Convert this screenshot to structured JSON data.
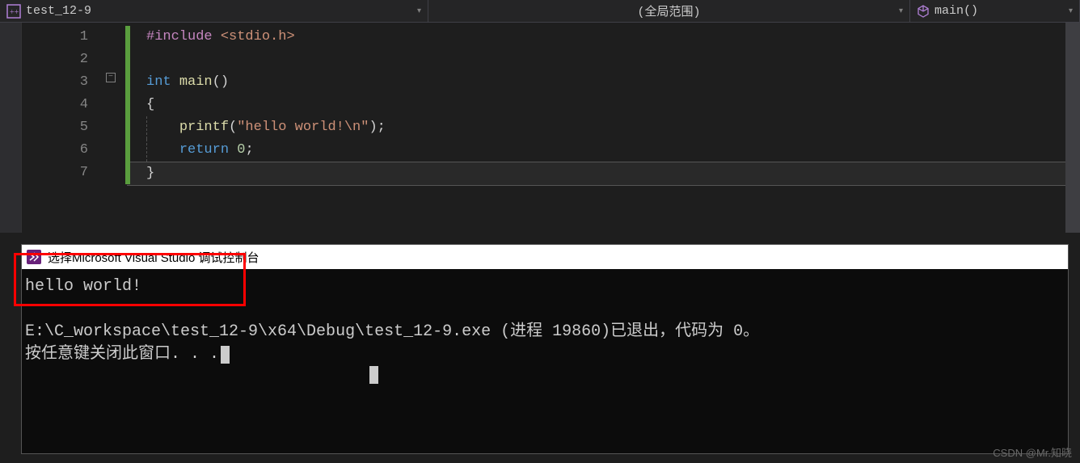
{
  "topbar": {
    "file_label": "test_12-9",
    "scope_label": "(全局范围)",
    "function_label": "main()"
  },
  "editor": {
    "line_numbers": [
      "1",
      "2",
      "3",
      "4",
      "5",
      "6",
      "7"
    ],
    "code": {
      "l1_include": "#include",
      "l1_header": "<stdio.h>",
      "l3_int": "int",
      "l3_main": "main",
      "l3_parens": "()",
      "l4_brace": "{",
      "l5_printf": "printf",
      "l5_open": "(",
      "l5_str": "\"hello world!\\n\"",
      "l5_close": ");",
      "l6_return": "return",
      "l6_zero": "0",
      "l6_semi": ";",
      "l7_brace": "}"
    }
  },
  "console": {
    "title": "选择Microsoft Visual Studio 调试控制台",
    "output_line1": "hello world!",
    "output_line2": "E:\\C_workspace\\test_12-9\\x64\\Debug\\test_12-9.exe (进程 19860)已退出，代码为 0。",
    "output_line3": "按任意键关闭此窗口. . ."
  },
  "watermark": "CSDN @Mr.知晓"
}
